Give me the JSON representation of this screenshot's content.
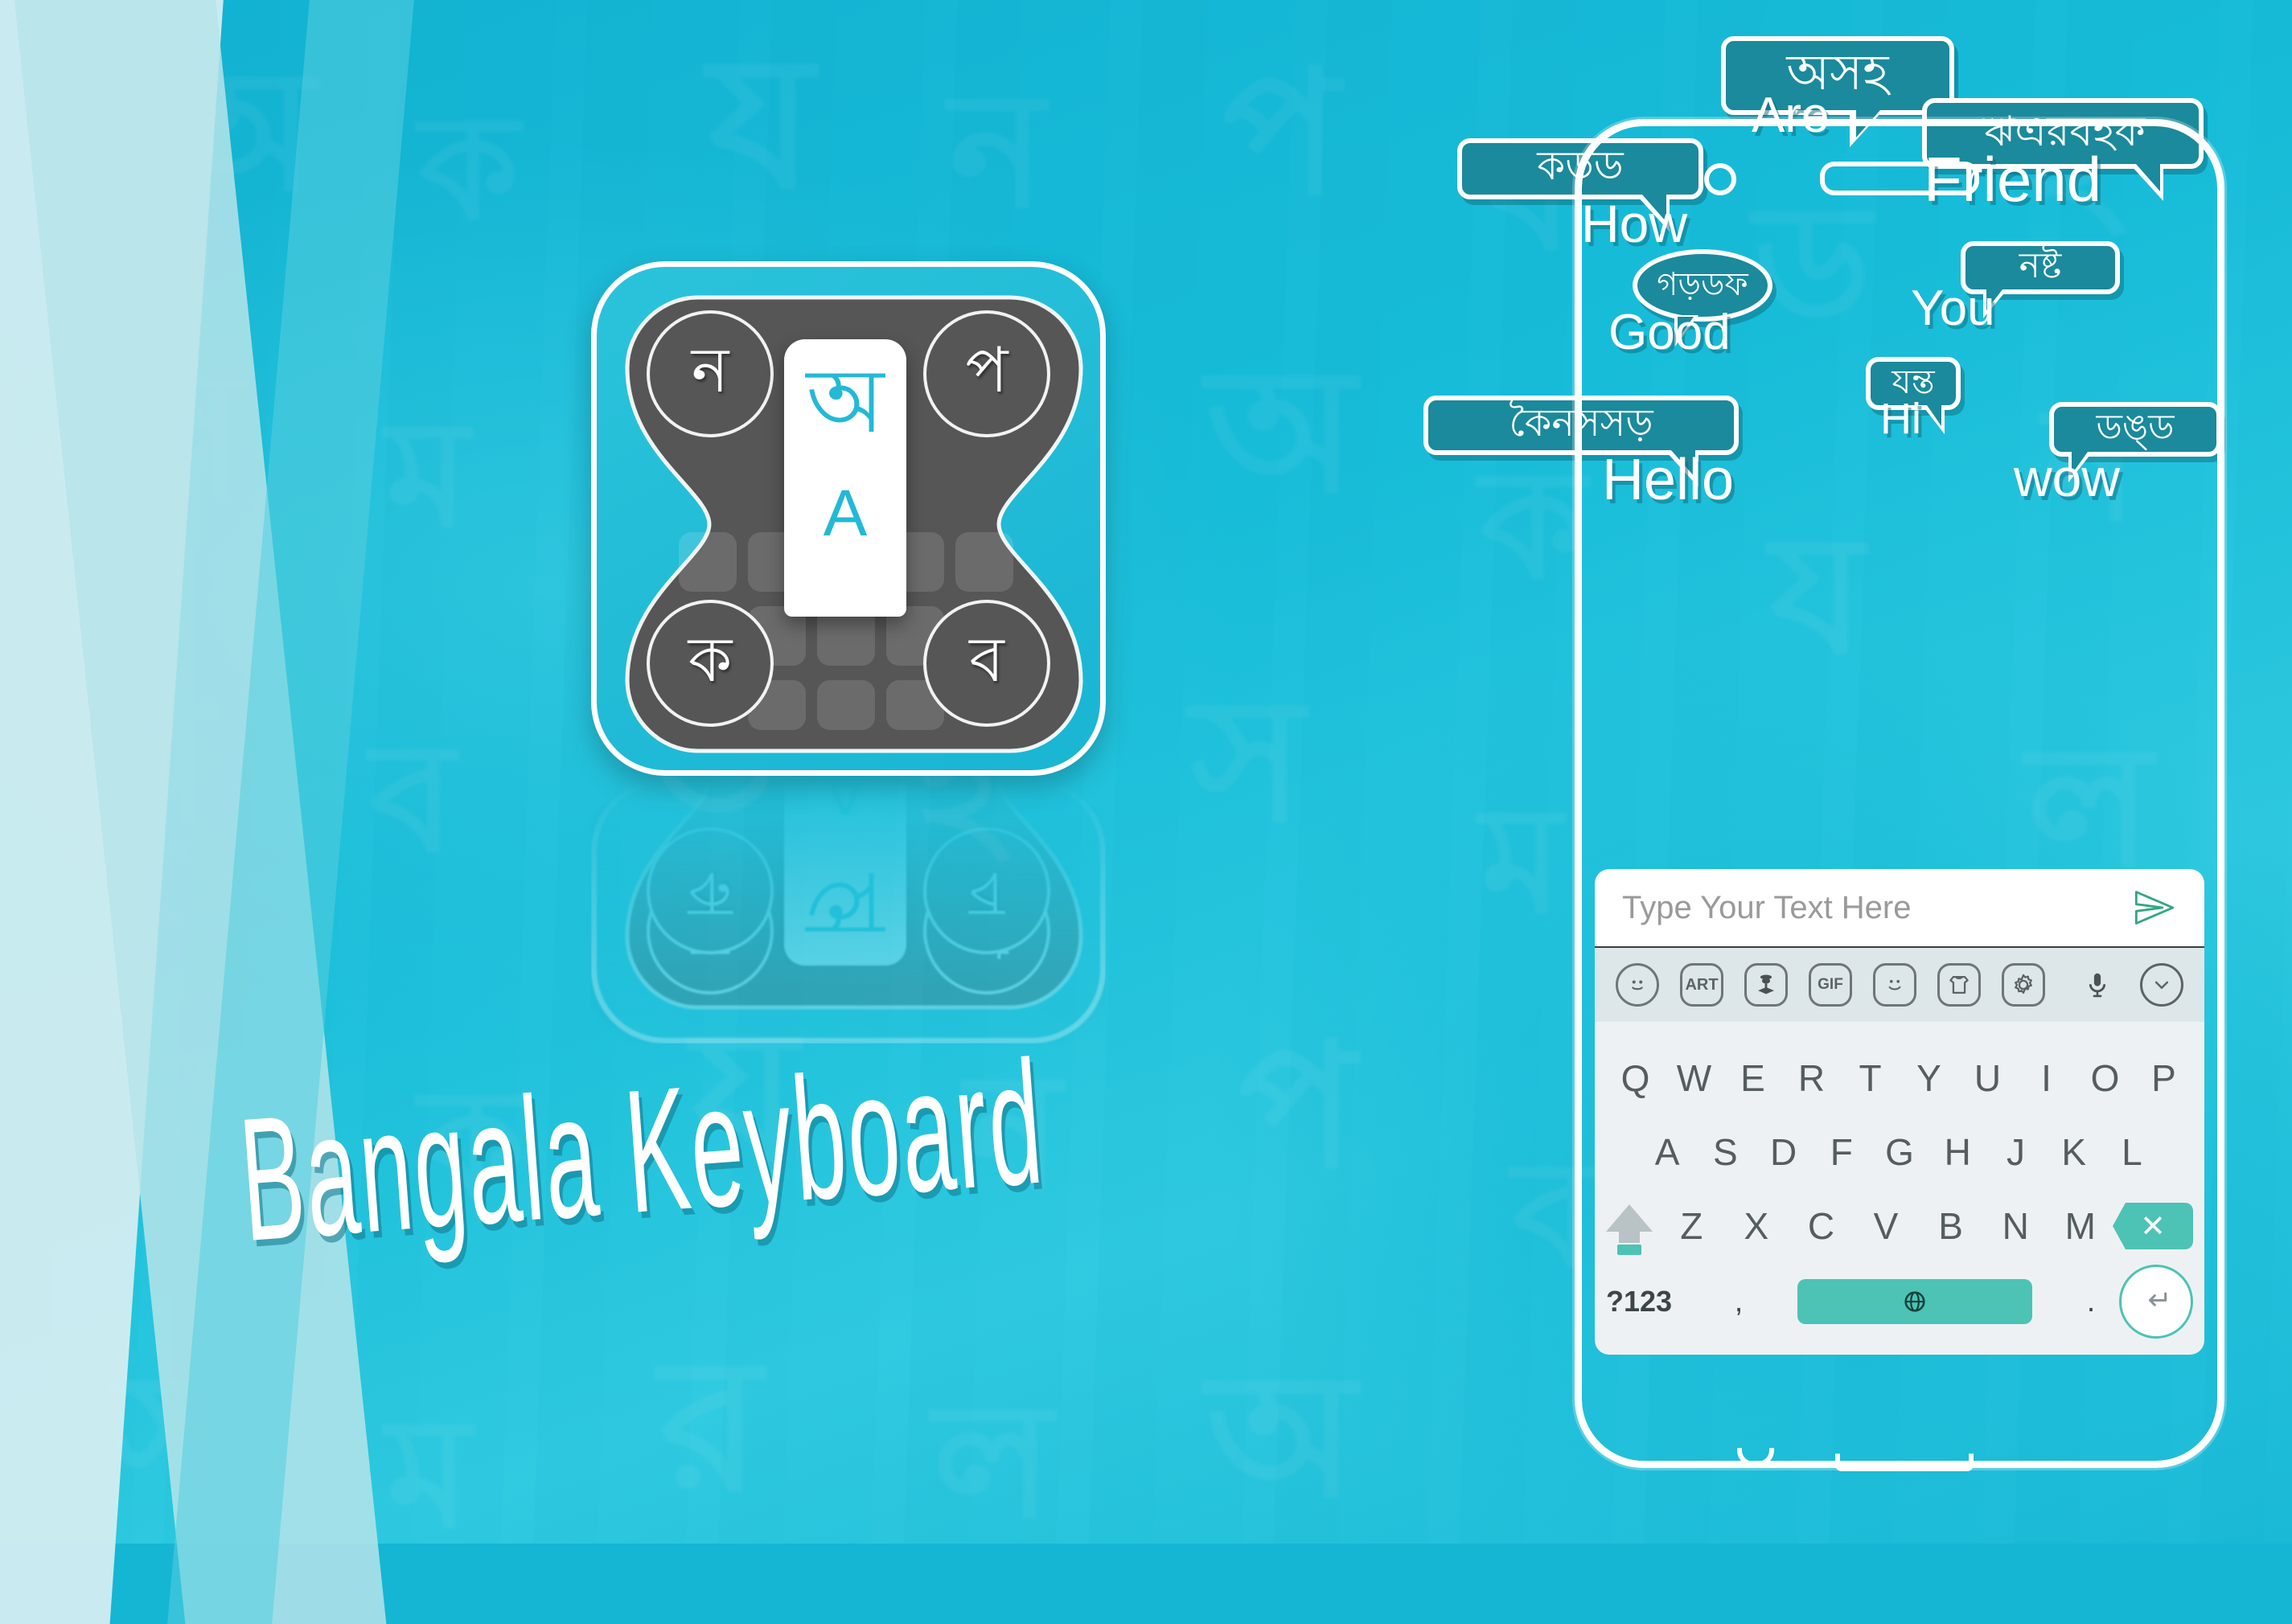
{
  "app": {
    "title": "Bangala Keyboard",
    "icon": {
      "center_bengali": "অ",
      "center_latin": "A",
      "corner_top_left": "ন",
      "corner_top_right": "প",
      "corner_bottom_left": "ক",
      "corner_bottom_right": "ব"
    }
  },
  "colors": {
    "background_cyan": "#14b6d4",
    "bubble_teal": "#1a8a9c",
    "accent_white": "#ffffff",
    "icon_dark_gray": "#565656",
    "key_accent_mint": "#4cc3b5",
    "icon_text_blue": "#23b9d6"
  },
  "bubbles": [
    {
      "bengali": "অসহ",
      "english": "Are",
      "shape": "rect"
    },
    {
      "bengali": "ঋএরবহফ",
      "english": "Friend",
      "shape": "rect"
    },
    {
      "bengali": "কড়ড",
      "english": "How",
      "shape": "rect"
    },
    {
      "bengali": "গড়ডফ",
      "english": "Good",
      "shape": "circle"
    },
    {
      "bengali": "নষ্ট",
      "english": "You",
      "shape": "rect"
    },
    {
      "bengali": "যন্ত",
      "english": "Hi",
      "shape": "rect"
    },
    {
      "bengali": "কৈনসসড়",
      "english": "Hello",
      "shape": "rect"
    },
    {
      "bengali": "ডঙ্ড",
      "english": "wow",
      "shape": "rect"
    }
  ],
  "phone": {
    "input": {
      "placeholder": "Type Your Text Here",
      "value": ""
    },
    "send_icon": "send-paper-plane-icon",
    "toolbar": [
      {
        "name": "emoji-icon",
        "label": "☺"
      },
      {
        "name": "art-icon",
        "label": "ART"
      },
      {
        "name": "sticker-icon",
        "label": "♟"
      },
      {
        "name": "gif-icon",
        "label": "GIF"
      },
      {
        "name": "smiley-icon",
        "label": "☺"
      },
      {
        "name": "theme-icon",
        "label": "♆"
      },
      {
        "name": "settings-icon",
        "label": "⚙"
      },
      {
        "name": "microphone-icon",
        "label": "🎤"
      },
      {
        "name": "collapse-icon",
        "label": "⌄"
      }
    ],
    "keyboard": {
      "row1": [
        "Q",
        "W",
        "E",
        "R",
        "T",
        "Y",
        "U",
        "I",
        "O",
        "P"
      ],
      "row2": [
        "A",
        "S",
        "D",
        "F",
        "G",
        "H",
        "J",
        "K",
        "L"
      ],
      "row3": [
        "Z",
        "X",
        "C",
        "V",
        "B",
        "N",
        "M"
      ],
      "shift_label": "shift-key",
      "backspace_label": "✕",
      "numeric_label": "?123",
      "comma_label": ",",
      "period_label": ".",
      "space_label": "🌐",
      "enter_label": "↵"
    }
  },
  "background_watermarks": [
    "অ",
    "ক",
    "য",
    "ন",
    "প",
    "ব",
    "ড",
    "হ",
    "স",
    "ম",
    "র",
    "ল"
  ]
}
